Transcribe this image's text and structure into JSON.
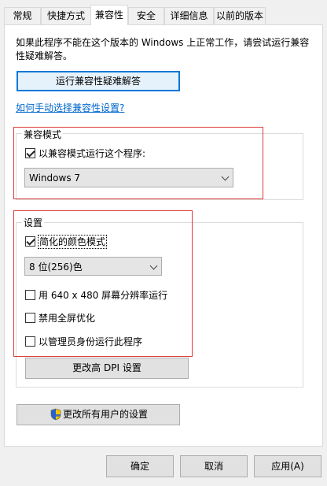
{
  "tabs": [
    {
      "label": "常规"
    },
    {
      "label": "快捷方式"
    },
    {
      "label": "兼容性"
    },
    {
      "label": "安全"
    },
    {
      "label": "详细信息"
    },
    {
      "label": "以前的版本"
    }
  ],
  "active_tab": "兼容性",
  "intro_text": "如果此程序不能在这个版本的 Windows 上正常工作，请尝试运行兼容性疑难解答。",
  "troubleshooter_button": "运行兼容性疑难解答",
  "manual_link": "如何手动选择兼容性设置?",
  "compat_mode": {
    "group_label": "兼容模式",
    "checkbox_label": "以兼容模式运行这个程序:",
    "checked": true,
    "selected_os": "Windows 7"
  },
  "settings": {
    "group_label": "设置",
    "reduced_color": {
      "label": "简化的颜色模式",
      "checked": true
    },
    "color_select": "8 位(256)色",
    "run_640": {
      "label": "用 640 x 480 屏幕分辨率运行",
      "checked": false
    },
    "disable_fullscreen": {
      "label": "禁用全屏优化",
      "checked": false
    },
    "run_admin": {
      "label": "以管理员身份运行此程序",
      "checked": false
    },
    "dpi_button": "更改高 DPI 设置"
  },
  "all_users_button": "更改所有用户的设置",
  "footer": {
    "ok": "确定",
    "cancel": "取消",
    "apply": "应用(A)"
  },
  "colors": {
    "highlight_border": "#e03a3a",
    "focus_border": "#0078d7",
    "link": "#0066cc"
  }
}
